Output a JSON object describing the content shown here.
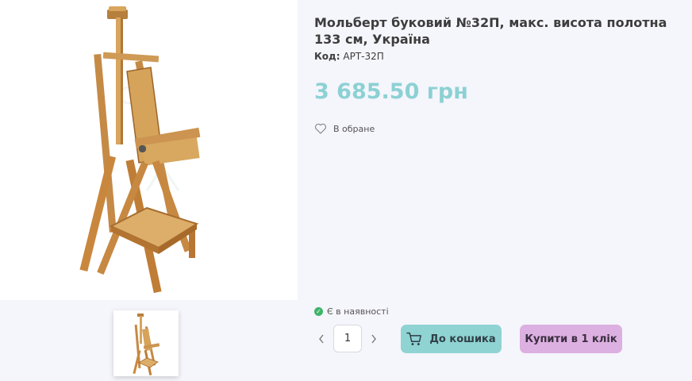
{
  "product": {
    "title": "Мольберт буковий №32П, макс. висота полотна 133 см, Україна",
    "code_label": "Код:",
    "code_value": "АРТ-32П",
    "price": "3 685.50 грн"
  },
  "favorites": {
    "label": "В обране",
    "icon": "heart-icon"
  },
  "availability": {
    "label": "Є в наявності",
    "icon": "check-circle-icon",
    "color": "#3fb46a"
  },
  "quantity": {
    "value": "1",
    "decrement_icon": "chevron-left-icon",
    "increment_icon": "chevron-right-icon"
  },
  "actions": {
    "add_to_cart": "До кошика",
    "add_to_cart_icon": "cart-icon",
    "buy_one_click": "Купити в 1 клік"
  },
  "colors": {
    "price": "#8cd1d3",
    "cart_button": "#8fd3d2",
    "buy_button": "#dcb0e0",
    "background": "#f5f5fc"
  }
}
